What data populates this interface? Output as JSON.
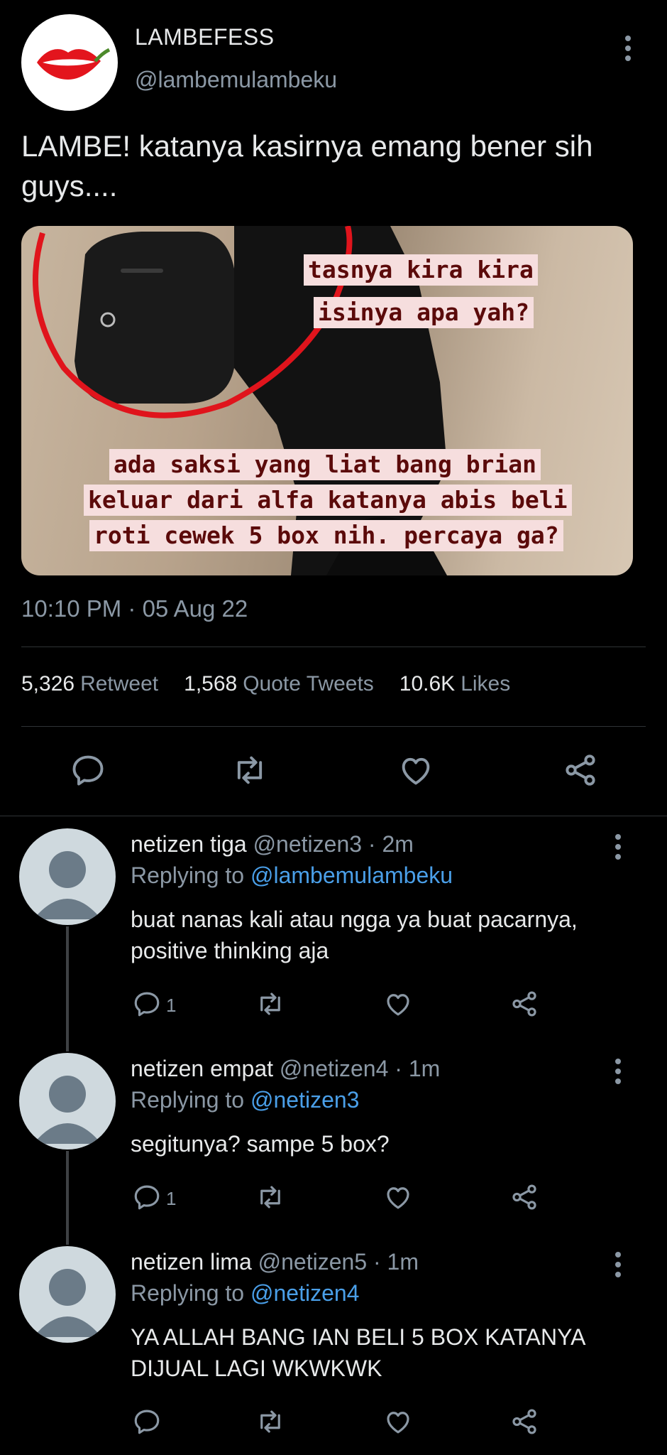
{
  "tweet": {
    "author_name": "LAMBEFESS",
    "author_handle": "@lambemulambeku",
    "text": "LAMBE! katanya kasirnya emang bener sih guys....",
    "image_caption_top": [
      "tasnya kira kira",
      "isinya apa yah?"
    ],
    "image_caption_bottom": [
      "ada saksi yang liat bang brian",
      "keluar dari alfa katanya abis beli",
      "roti cewek 5 box nih. percaya ga?"
    ],
    "timestamp": "10:10 PM · 05 Aug 22",
    "stats": {
      "retweets_count": "5,326",
      "retweets_label": "Retweet",
      "quotes_count": "1,568",
      "quotes_label": "Quote Tweets",
      "likes_count": "10.6K",
      "likes_label": "Likes"
    }
  },
  "icons": [
    "reply-icon",
    "retweet-icon",
    "like-icon",
    "share-icon",
    "more-icon",
    "lips-logo-icon",
    "default-avatar-icon"
  ],
  "replies": [
    {
      "name": "netizen tiga",
      "handle": "@netizen3",
      "time": "· 2m",
      "replying_label": "Replying to",
      "replying_to": "@lambemulambeku",
      "text": "buat nanas kali atau ngga ya buat pacarnya, positive thinking aja",
      "reply_count": "1"
    },
    {
      "name": "netizen empat",
      "handle": "@netizen4",
      "time": "· 1m",
      "replying_label": "Replying to",
      "replying_to": "@netizen3",
      "text": "segitunya? sampe 5 box?",
      "reply_count": "1"
    },
    {
      "name": "netizen lima",
      "handle": "@netizen5",
      "time": "· 1m",
      "replying_label": "Replying to",
      "replying_to": "@netizen4",
      "text": "YA ALLAH BANG IAN BELI 5 BOX KATANYA DIJUAL LAGI WKWKWK",
      "reply_count": ""
    }
  ],
  "colors": {
    "background": "#000000",
    "text": "#e7e9ea",
    "muted": "#8b98a5",
    "link": "#4a9fe8",
    "divider": "#2f3336"
  }
}
